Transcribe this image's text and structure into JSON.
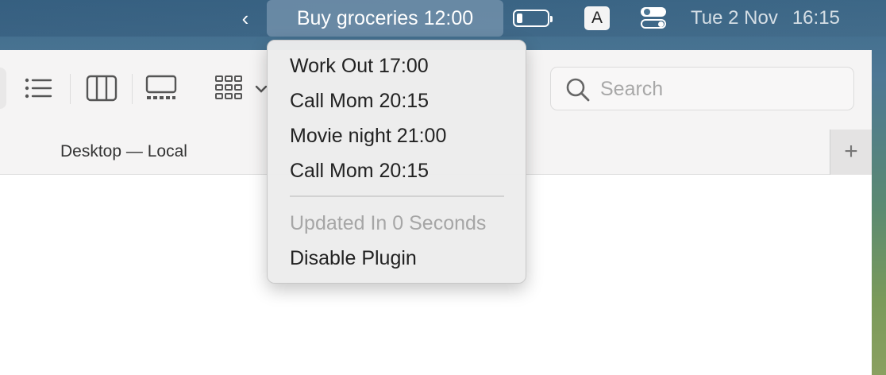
{
  "menubar": {
    "event_label": "Buy groceries 12:00",
    "input_source": "A",
    "date": "Tue 2 Nov",
    "time": "16:15",
    "battery_level": 0.2
  },
  "finder": {
    "search_placeholder": "Search",
    "tab_title": "Desktop — Local",
    "add_tab_label": "+"
  },
  "dropdown": {
    "events": [
      "Work Out 17:00",
      "Call Mom 20:15",
      "Movie night 21:00",
      "Call Mom 20:15"
    ],
    "status": "Updated In 0 Seconds",
    "disable_label": "Disable Plugin"
  },
  "colors": {
    "menubar_highlight": "#7896af",
    "menu_background": "#ececec",
    "disabled_text": "#a6a6a6"
  }
}
